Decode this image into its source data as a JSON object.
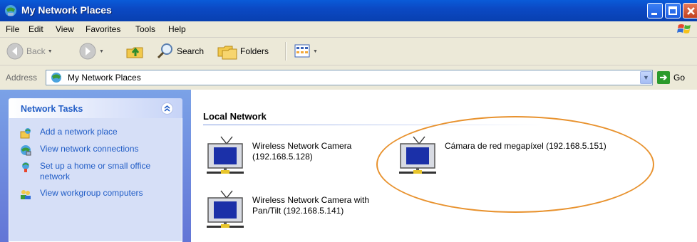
{
  "window": {
    "title": "My Network Places"
  },
  "menu": [
    "File",
    "Edit",
    "View",
    "Favorites",
    "Tools",
    "Help"
  ],
  "toolbar": {
    "back": "Back",
    "search": "Search",
    "folders": "Folders"
  },
  "address": {
    "label": "Address",
    "value": "My Network Places",
    "go": "Go"
  },
  "tasks": {
    "title": "Network Tasks",
    "items": [
      "Add a network place",
      "View network connections",
      "Set up a home or small office network",
      "View workgroup computers"
    ]
  },
  "content": {
    "group": "Local Network",
    "items": [
      {
        "line1": "Wireless Network Camera",
        "line2": "(192.168.5.128)"
      },
      {
        "line1": "Cámara de red megapíxel (192.168.5.151)",
        "line2": ""
      },
      {
        "line1": "Wireless Network Camera with",
        "line2": "Pan/Tilt (192.168.5.141)"
      }
    ]
  },
  "colors": {
    "titlebar": "#0b49c4",
    "task_link": "#215dc6",
    "highlight": "#e8922e"
  }
}
